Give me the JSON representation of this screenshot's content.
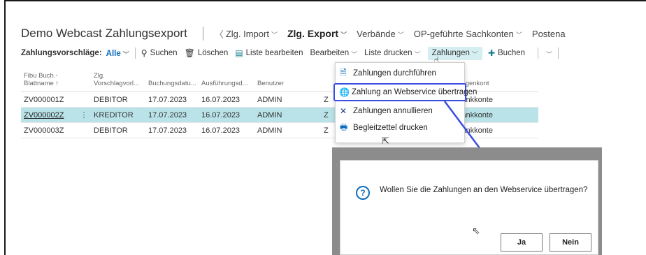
{
  "header": {
    "app_title": "Demo Webcast Zahlungsexport",
    "nav": [
      {
        "label": "Zlg. Import",
        "bold": false
      },
      {
        "label": "Zlg. Export",
        "bold": true
      },
      {
        "label": "Verbände",
        "bold": false
      },
      {
        "label": "OP-geführte Sachkonten",
        "bold": false
      },
      {
        "label": "Postena",
        "bold": false
      }
    ]
  },
  "actionbar": {
    "label": "Zahlungsvorschläge:",
    "filter": "Alle",
    "search": "Suchen",
    "delete": "Löschen",
    "edit_list": "Liste bearbeiten",
    "edit": "Bearbeiten",
    "print_list": "Liste drucken",
    "payments": "Zahlungen",
    "post": "Buchen"
  },
  "table": {
    "headers": [
      "Fibu Buch.-\nBlattname ↑",
      "Zlg.\nVorschlagvorl...",
      "Buchungsdatu...",
      "Ausführungsd...",
      "Benutzer",
      "",
      "Gegenkont"
    ],
    "rows": [
      {
        "name": "ZV000001Z",
        "type": "DEBITOR",
        "posting_date": "17.07.2023",
        "exec_date": "16.07.2023",
        "user": "ADMIN",
        "mid": "Z",
        "account": "Bankkonte",
        "selected": false
      },
      {
        "name": "ZV000002Z",
        "type": "KREDITOR",
        "posting_date": "17.07.2023",
        "exec_date": "16.07.2023",
        "user": "ADMIN",
        "mid": "Z",
        "account": "Bankkonte",
        "selected": true
      },
      {
        "name": "ZV000003Z",
        "type": "DEBITOR",
        "posting_date": "17.07.2023",
        "exec_date": "16.07.2023",
        "user": "ADMIN",
        "mid": "Z",
        "account": "Bankkonte",
        "selected": false
      }
    ],
    "row_menu": "⋮"
  },
  "dropdown": {
    "items": [
      {
        "label": "Zahlungen durchführen",
        "icon": "document-check-icon"
      },
      {
        "label": "Zahlung an Webservice übertragen",
        "icon": "globe-icon"
      },
      {
        "label": "Zahlungen annullieren",
        "icon": "x-icon"
      },
      {
        "label": "Begleitzettel drucken",
        "icon": "print-document-icon"
      }
    ]
  },
  "dialog": {
    "message": "Wollen Sie die Zahlungen an den Webservice übertragen?",
    "yes": "Ja",
    "no": "Nein",
    "icon": "question-icon"
  },
  "colors": {
    "accent": "#0f6cbd",
    "selection": "#b9e3e8",
    "highlight_box": "#3b4de0"
  }
}
